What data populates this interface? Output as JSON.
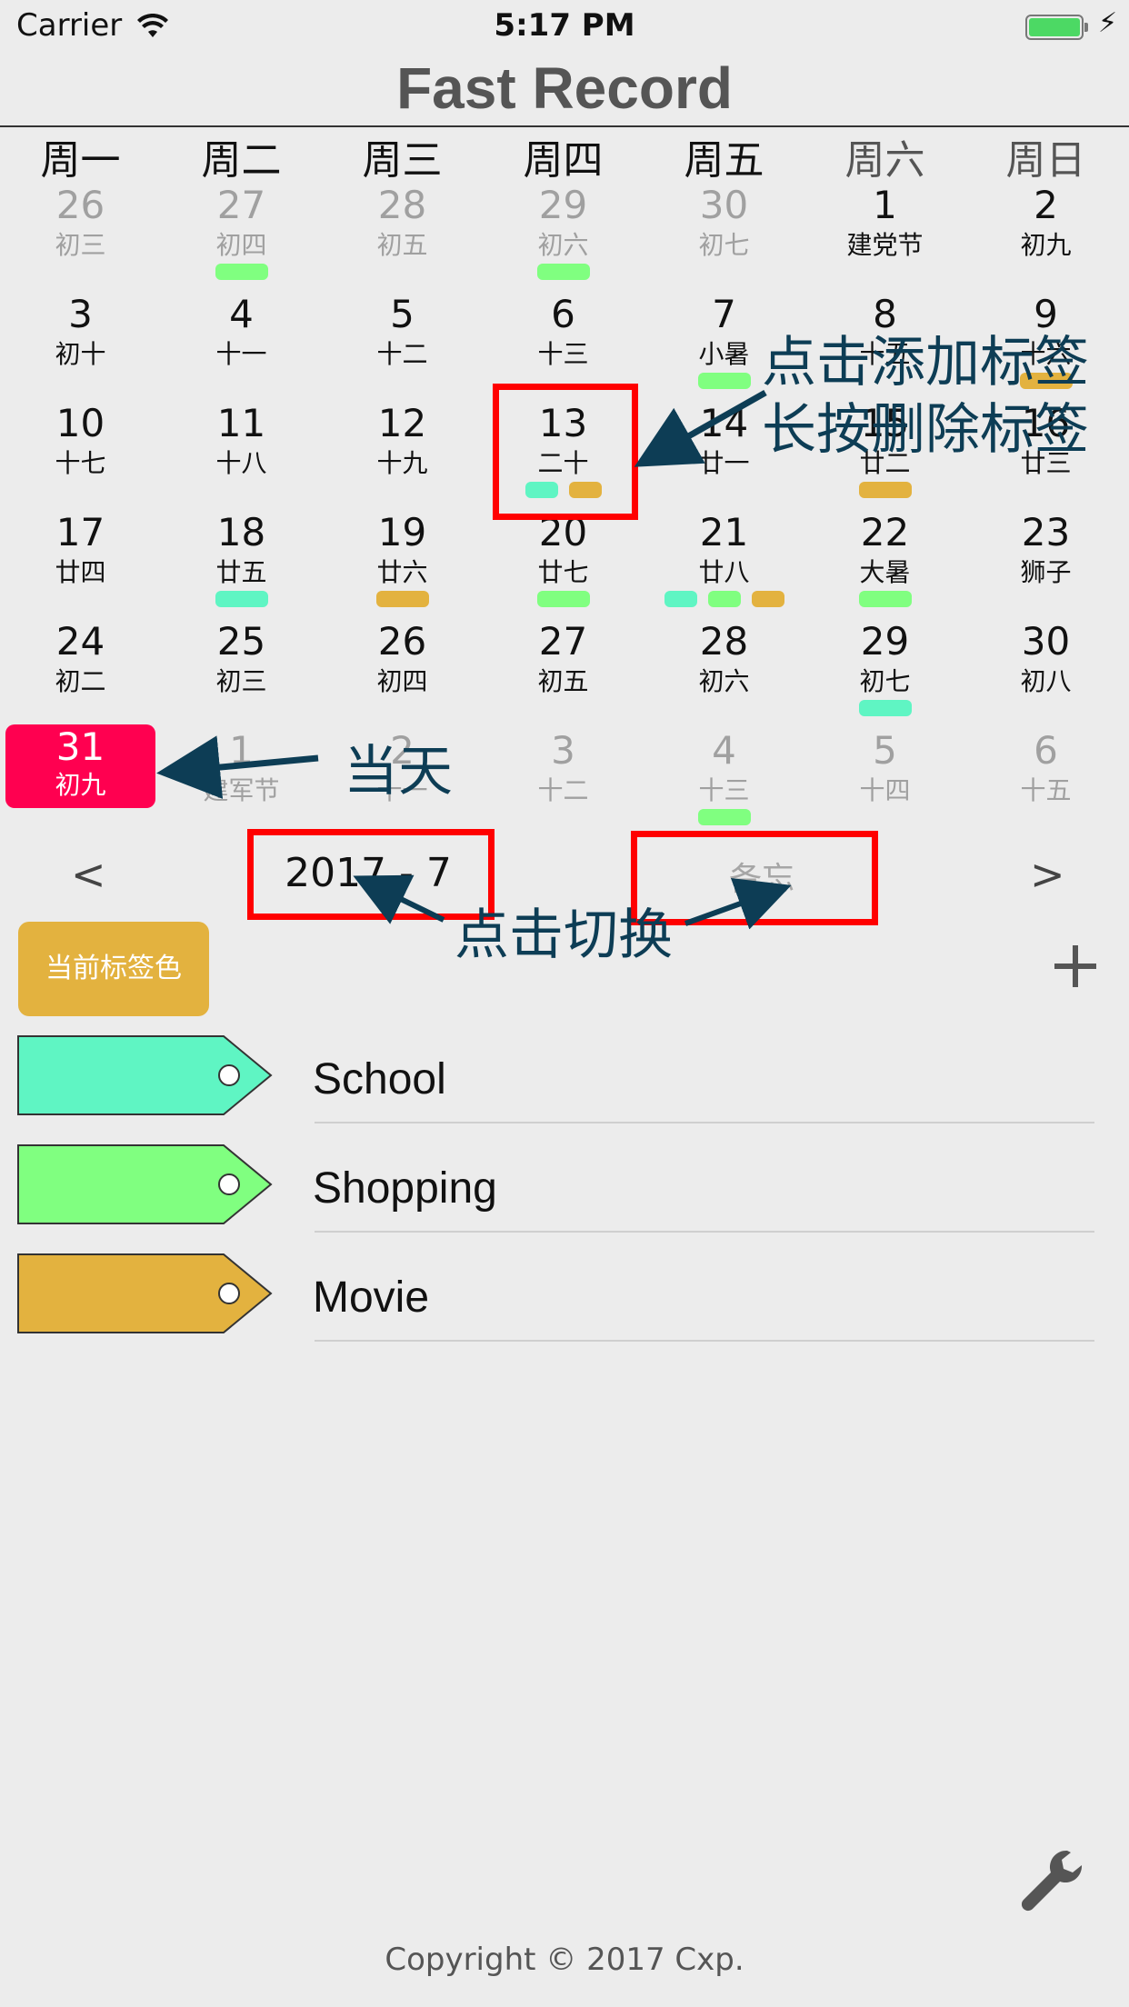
{
  "status_bar": {
    "carrier": "Carrier",
    "time": "5:17 PM",
    "charging": "⚡"
  },
  "app_title": "Fast Record",
  "weekdays": [
    "周一",
    "周二",
    "周三",
    "周四",
    "周五",
    "周六",
    "周日"
  ],
  "colors": {
    "school": "#5ff5c3",
    "shopping": "#80ff80",
    "movie": "#e3b23f",
    "today": "#ff0050",
    "annotation": "#0d3d55"
  },
  "calendar": {
    "rows": [
      [
        {
          "day": "26",
          "lunar": "初三",
          "dim": true,
          "tags": []
        },
        {
          "day": "27",
          "lunar": "初四",
          "dim": true,
          "tags": [
            "shopping"
          ]
        },
        {
          "day": "28",
          "lunar": "初五",
          "dim": true,
          "tags": []
        },
        {
          "day": "29",
          "lunar": "初六",
          "dim": true,
          "tags": [
            "shopping"
          ]
        },
        {
          "day": "30",
          "lunar": "初七",
          "dim": true,
          "tags": []
        },
        {
          "day": "1",
          "lunar": "建党节",
          "dim": false,
          "tags": []
        },
        {
          "day": "2",
          "lunar": "初九",
          "dim": false,
          "tags": []
        }
      ],
      [
        {
          "day": "3",
          "lunar": "初十",
          "dim": false,
          "tags": []
        },
        {
          "day": "4",
          "lunar": "十一",
          "dim": false,
          "tags": []
        },
        {
          "day": "5",
          "lunar": "十二",
          "dim": false,
          "tags": []
        },
        {
          "day": "6",
          "lunar": "十三",
          "dim": false,
          "tags": []
        },
        {
          "day": "7",
          "lunar": "小暑",
          "dim": false,
          "tags": [
            "shopping"
          ]
        },
        {
          "day": "8",
          "lunar": "十五",
          "dim": false,
          "tags": []
        },
        {
          "day": "9",
          "lunar": "十六",
          "dim": false,
          "tags": [
            "movie"
          ]
        }
      ],
      [
        {
          "day": "10",
          "lunar": "十七",
          "dim": false,
          "tags": []
        },
        {
          "day": "11",
          "lunar": "十八",
          "dim": false,
          "tags": []
        },
        {
          "day": "12",
          "lunar": "十九",
          "dim": false,
          "tags": []
        },
        {
          "day": "13",
          "lunar": "二十",
          "dim": false,
          "tags": [
            "school",
            "movie"
          ]
        },
        {
          "day": "14",
          "lunar": "廿一",
          "dim": false,
          "tags": []
        },
        {
          "day": "15",
          "lunar": "廿二",
          "dim": false,
          "tags": [
            "movie"
          ]
        },
        {
          "day": "16",
          "lunar": "廿三",
          "dim": false,
          "tags": []
        }
      ],
      [
        {
          "day": "17",
          "lunar": "廿四",
          "dim": false,
          "tags": []
        },
        {
          "day": "18",
          "lunar": "廿五",
          "dim": false,
          "tags": [
            "school"
          ]
        },
        {
          "day": "19",
          "lunar": "廿六",
          "dim": false,
          "tags": [
            "movie"
          ]
        },
        {
          "day": "20",
          "lunar": "廿七",
          "dim": false,
          "tags": [
            "shopping"
          ]
        },
        {
          "day": "21",
          "lunar": "廿八",
          "dim": false,
          "tags": [
            "school",
            "shopping",
            "movie"
          ]
        },
        {
          "day": "22",
          "lunar": "大暑",
          "dim": false,
          "tags": [
            "shopping"
          ]
        },
        {
          "day": "23",
          "lunar": "狮子",
          "dim": false,
          "tags": []
        }
      ],
      [
        {
          "day": "24",
          "lunar": "初二",
          "dim": false,
          "tags": []
        },
        {
          "day": "25",
          "lunar": "初三",
          "dim": false,
          "tags": []
        },
        {
          "day": "26",
          "lunar": "初四",
          "dim": false,
          "tags": []
        },
        {
          "day": "27",
          "lunar": "初五",
          "dim": false,
          "tags": []
        },
        {
          "day": "28",
          "lunar": "初六",
          "dim": false,
          "tags": []
        },
        {
          "day": "29",
          "lunar": "初七",
          "dim": false,
          "tags": [
            "school"
          ]
        },
        {
          "day": "30",
          "lunar": "初八",
          "dim": false,
          "tags": []
        }
      ],
      [
        {
          "day": "31",
          "lunar": "初九",
          "dim": false,
          "today": true,
          "tags": []
        },
        {
          "day": "1",
          "lunar": "建军节",
          "dim": true,
          "tags": []
        },
        {
          "day": "2",
          "lunar": "十一",
          "dim": true,
          "tags": []
        },
        {
          "day": "3",
          "lunar": "十二",
          "dim": true,
          "tags": []
        },
        {
          "day": "4",
          "lunar": "十三",
          "dim": true,
          "tags": [
            "shopping"
          ]
        },
        {
          "day": "5",
          "lunar": "十四",
          "dim": true,
          "tags": []
        },
        {
          "day": "6",
          "lunar": "十五",
          "dim": true,
          "tags": []
        }
      ]
    ]
  },
  "nav": {
    "prev": "<",
    "month": "2017 - 7",
    "memo": "备忘",
    "next": ">"
  },
  "color_button": "当前标签色",
  "tags": [
    {
      "name": "School",
      "color": "#5ff5c3"
    },
    {
      "name": "Shopping",
      "color": "#80ff80"
    },
    {
      "name": "Movie",
      "color": "#e3b23f"
    }
  ],
  "annotations": {
    "add_tag": "点击添加标签",
    "delete_tag": "长按删除标签",
    "today": "当天",
    "switch": "点击切换"
  },
  "footer": {
    "copyright": "Copyright © 2017 Cxp."
  }
}
